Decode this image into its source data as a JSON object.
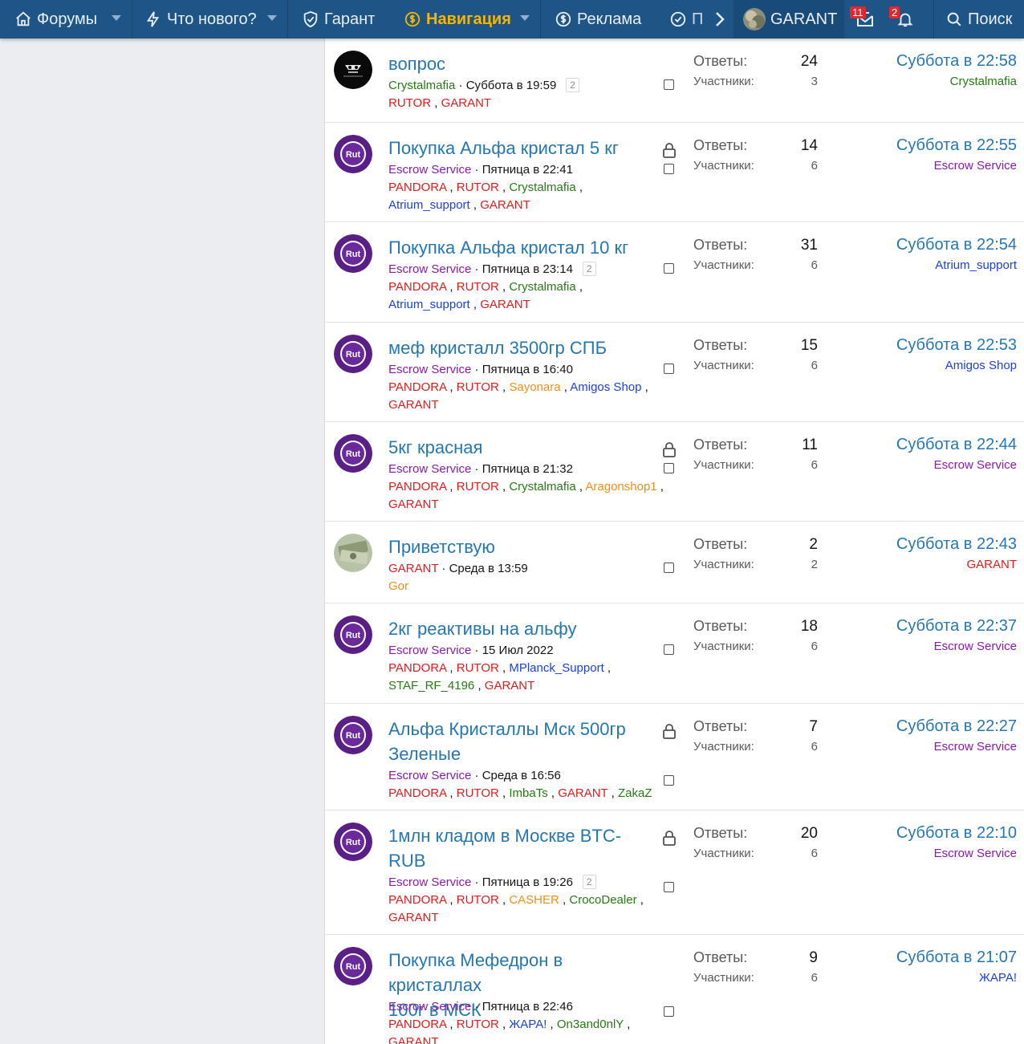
{
  "nav": {
    "forums": "Форумы",
    "whats_new": "Что нового?",
    "garant": "Гарант",
    "navigation": "Навигация",
    "ads": "Реклама",
    "truncated": "П",
    "username": "GARANT",
    "inbox_count": "11",
    "alerts_count": "2",
    "search": "Поиск"
  },
  "labels": {
    "replies": "Ответы:",
    "participants": "Участники:"
  },
  "colors": {
    "navbar": "#1d5586",
    "accent": "#f7b500",
    "link": "#2577b1",
    "badge": "#e0282e"
  },
  "threads": [
    {
      "title_lines": [
        "вопрос"
      ],
      "author": "Crystalmafia",
      "author_color": "green",
      "date": "Суббота в 19:59",
      "pages": "2",
      "locked": false,
      "tags": [
        [
          {
            "t": "RUTOR",
            "c": "red"
          },
          {
            "t": "GARANT",
            "c": "red"
          }
        ]
      ],
      "replies": "24",
      "participants": "3",
      "last_time": "Суббота в 22:58",
      "last_user": "Crystalmafia",
      "last_color": "green",
      "avatar": "crystal"
    },
    {
      "title_lines": [
        "Покупка Альфа кристал 5 кг"
      ],
      "author": "Escrow Service",
      "author_color": "purple",
      "date": "Пятница в 22:41",
      "pages": "",
      "locked": true,
      "tags": [
        [
          {
            "t": "PANDORA",
            "c": "red"
          },
          {
            "t": "RUTOR",
            "c": "red"
          },
          {
            "t": "Crystalmafia",
            "c": "green"
          }
        ],
        [
          {
            "t": "Atrium_support",
            "c": "blue"
          },
          {
            "t": "GARANT",
            "c": "red"
          }
        ]
      ],
      "replies": "14",
      "participants": "6",
      "last_time": "Суббота в 22:55",
      "last_user": "Escrow Service",
      "last_color": "purple",
      "avatar": "rutor"
    },
    {
      "title_lines": [
        "Покупка Альфа кристал 10 кг"
      ],
      "author": "Escrow Service",
      "author_color": "purple",
      "date": "Пятница в 23:14",
      "pages": "2",
      "locked": false,
      "tags": [
        [
          {
            "t": "PANDORA",
            "c": "red"
          },
          {
            "t": "RUTOR",
            "c": "red"
          },
          {
            "t": "Crystalmafia",
            "c": "green"
          }
        ],
        [
          {
            "t": "Atrium_support",
            "c": "blue"
          },
          {
            "t": "GARANT",
            "c": "red"
          }
        ]
      ],
      "replies": "31",
      "participants": "6",
      "last_time": "Суббота в 22:54",
      "last_user": "Atrium_support",
      "last_color": "blue",
      "avatar": "rutor"
    },
    {
      "title_lines": [
        "меф кристалл 3500гр СПБ"
      ],
      "author": "Escrow Service",
      "author_color": "purple",
      "date": "Пятница в 16:40",
      "pages": "",
      "locked": false,
      "tags": [
        [
          {
            "t": "PANDORA",
            "c": "red"
          },
          {
            "t": "RUTOR",
            "c": "red"
          },
          {
            "t": "Sayonara",
            "c": "orange"
          },
          {
            "t": "Amigos Shop",
            "c": "blue"
          }
        ],
        [
          {
            "t": "GARANT",
            "c": "red"
          }
        ]
      ],
      "replies": "15",
      "participants": "6",
      "last_time": "Суббота в 22:53",
      "last_user": "Amigos Shop",
      "last_color": "blue",
      "avatar": "rutor"
    },
    {
      "title_lines": [
        "5кг красная"
      ],
      "author": "Escrow Service",
      "author_color": "purple",
      "date": "Пятница в 21:32",
      "pages": "",
      "locked": true,
      "tags": [
        [
          {
            "t": "PANDORA",
            "c": "red"
          },
          {
            "t": "RUTOR",
            "c": "red"
          },
          {
            "t": "Crystalmafia",
            "c": "green"
          },
          {
            "t": "Aragonshop1",
            "c": "orange"
          }
        ],
        [
          {
            "t": "GARANT",
            "c": "red"
          }
        ]
      ],
      "replies": "11",
      "participants": "6",
      "last_time": "Суббота в 22:44",
      "last_user": "Escrow Service",
      "last_color": "purple",
      "avatar": "rutor"
    },
    {
      "title_lines": [
        "Приветствую"
      ],
      "author": "GARANT",
      "author_color": "red",
      "date": "Среда в 13:59",
      "pages": "",
      "locked": false,
      "tags": [
        [
          {
            "t": "Gor",
            "c": "orange"
          }
        ]
      ],
      "replies": "2",
      "participants": "2",
      "last_time": "Суббота в 22:43",
      "last_user": "GARANT",
      "last_color": "red",
      "avatar": "money"
    },
    {
      "title_lines": [
        "2кг реактивы на альфу"
      ],
      "author": "Escrow Service",
      "author_color": "purple",
      "date": "15 Июл 2022",
      "pages": "",
      "locked": false,
      "tags": [
        [
          {
            "t": "PANDORA",
            "c": "red"
          },
          {
            "t": "RUTOR",
            "c": "red"
          },
          {
            "t": "MPlanck_Support",
            "c": "blue"
          }
        ],
        [
          {
            "t": "STAF_RF_4196",
            "c": "green"
          },
          {
            "t": "GARANT",
            "c": "red"
          }
        ]
      ],
      "replies": "18",
      "participants": "6",
      "last_time": "Суббота в 22:37",
      "last_user": "Escrow Service",
      "last_color": "purple",
      "avatar": "rutor"
    },
    {
      "title_lines": [
        "Альфа Кристаллы Мск 500гр",
        "Зеленые"
      ],
      "author": "Escrow Service",
      "author_color": "purple",
      "date": "Среда в 16:56",
      "pages": "",
      "locked": true,
      "tags": [
        [
          {
            "t": "PANDORA",
            "c": "red"
          },
          {
            "t": "RUTOR",
            "c": "red"
          },
          {
            "t": "ImbaTs",
            "c": "green"
          },
          {
            "t": "GARANT",
            "c": "red"
          },
          {
            "t": "ZakaZ",
            "c": "green"
          }
        ]
      ],
      "replies": "7",
      "participants": "6",
      "last_time": "Суббота в 22:27",
      "last_user": "Escrow Service",
      "last_color": "purple",
      "avatar": "rutor"
    },
    {
      "title_lines": [
        "1млн кладом в Москве BTC-",
        "RUB"
      ],
      "author": "Escrow Service",
      "author_color": "purple",
      "date": "Пятница в 19:26",
      "pages": "2",
      "locked": true,
      "tags": [
        [
          {
            "t": "PANDORA",
            "c": "red"
          },
          {
            "t": "RUTOR",
            "c": "red"
          },
          {
            "t": "CASHER",
            "c": "orange"
          },
          {
            "t": "CrocoDealer",
            "c": "green"
          }
        ],
        [
          {
            "t": "GARANT",
            "c": "red"
          }
        ]
      ],
      "replies": "20",
      "participants": "6",
      "last_time": "Суббота в 22:10",
      "last_user": "Escrow Service",
      "last_color": "purple",
      "avatar": "rutor"
    },
    {
      "title_lines": [
        "Покупка Мефедрон в кристаллах",
        "100г в МСК"
      ],
      "author": "Escrow Service",
      "author_color": "purple",
      "date": "Пятница в 22:46",
      "pages": "",
      "locked": false,
      "tags": [
        [
          {
            "t": "PANDORA",
            "c": "red"
          },
          {
            "t": "RUTOR",
            "c": "red"
          },
          {
            "t": "ЖАРА!",
            "c": "blue"
          },
          {
            "t": "On3and0nlY",
            "c": "green"
          }
        ],
        [
          {
            "t": "GARANT",
            "c": "red"
          }
        ]
      ],
      "replies": "9",
      "participants": "6",
      "last_time": "Суббота в 21:07",
      "last_user": "ЖАРА!",
      "last_color": "blue",
      "avatar": "rutor"
    }
  ]
}
